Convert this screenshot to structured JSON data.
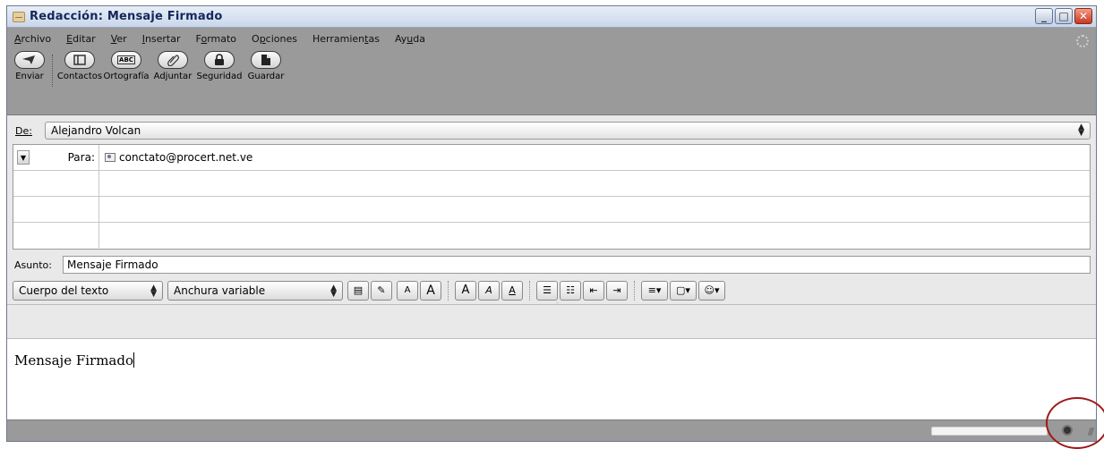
{
  "window": {
    "title": "Redacción: Mensaje Firmado"
  },
  "menu": [
    {
      "pre": "",
      "ul": "A",
      "post": "rchivo"
    },
    {
      "pre": "",
      "ul": "E",
      "post": "ditar"
    },
    {
      "pre": "",
      "ul": "V",
      "post": "er"
    },
    {
      "pre": "",
      "ul": "I",
      "post": "nsertar"
    },
    {
      "pre": "F",
      "ul": "o",
      "post": "rmato"
    },
    {
      "pre": "O",
      "ul": "p",
      "post": "ciones"
    },
    {
      "pre": "Herramien",
      "ul": "t",
      "post": "as"
    },
    {
      "pre": "Ay",
      "ul": "u",
      "post": "da"
    }
  ],
  "toolbar": {
    "send": "Enviar",
    "contacts": "Contactos",
    "spelling": "Ortografía",
    "spelling_glyph": "ABC",
    "attach": "Adjuntar",
    "security": "Seguridad",
    "save": "Guardar"
  },
  "from": {
    "label": "De:",
    "value": "Alejandro Volcan"
  },
  "recipients": [
    {
      "type": "Para:",
      "address": "conctato@procert.net.ve"
    }
  ],
  "subject": {
    "label": "Asunto:",
    "value": "Mensaje Firmado"
  },
  "format": {
    "paragraph_style": "Cuerpo del texto",
    "font_width": "Anchura variable",
    "small_font": "A",
    "large_font": "A",
    "bold": "A",
    "italic": "A",
    "underline": "A"
  },
  "body": {
    "text": "Mensaje Firmado"
  },
  "icons": {
    "send": "send-icon",
    "contacts": "address-book-icon",
    "spelling": "spellcheck-icon",
    "attach": "paperclip-icon",
    "security": "lock-icon",
    "save": "save-icon",
    "status_security": "security-seal-icon"
  },
  "colors": {
    "toolbar_bg": "#9a9a9a",
    "title_text": "#15275a",
    "highlight": "#a01818"
  }
}
